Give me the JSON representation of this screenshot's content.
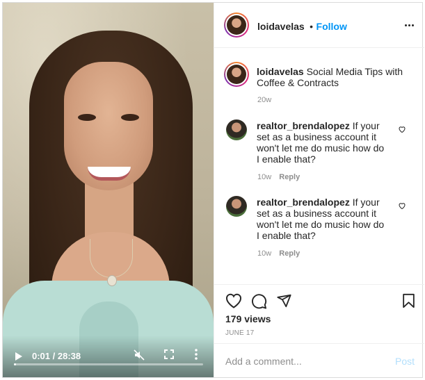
{
  "video": {
    "time": "0:01 / 28:38",
    "progress": 0.01
  },
  "header": {
    "username": "loidavelas",
    "separator": "•",
    "follow_label": "Follow"
  },
  "caption": {
    "username": "loidavelas",
    "text": "Social Media Tips with Coffee & Contracts",
    "age": "20w"
  },
  "comments": [
    {
      "username": "realtor_brendalopez",
      "text": "If your set as a business account it won't let me do music how do I enable that?",
      "age": "10w",
      "reply_label": "Reply"
    },
    {
      "username": "realtor_brendalopez",
      "text": "If your set as a business account it won't let me do music how do I enable that?",
      "age": "10w",
      "reply_label": "Reply"
    }
  ],
  "stats": {
    "views": "179 views",
    "date": "JUNE 17"
  },
  "composer": {
    "placeholder": "Add a comment...",
    "post_label": "Post"
  },
  "colors": {
    "accent": "#0095f6",
    "post_disabled": "#b2dffc",
    "muted": "#8e8e8e"
  },
  "icons": [
    "play-icon",
    "mute-icon",
    "fullscreen-icon",
    "more-vertical-icon",
    "more-horizontal-icon",
    "heart-icon",
    "comment-icon",
    "share-icon",
    "bookmark-icon"
  ]
}
